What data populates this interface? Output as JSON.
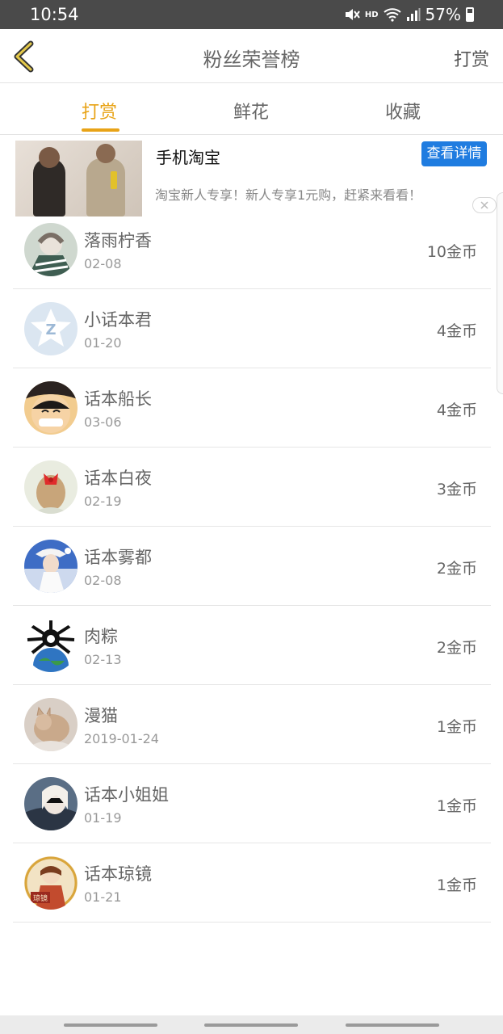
{
  "status": {
    "time": "10:54",
    "battery": "57%",
    "network_label": "HD"
  },
  "header": {
    "title": "粉丝荣誉榜",
    "right_action": "打赏"
  },
  "tabs": [
    {
      "label": "打赏",
      "active": true
    },
    {
      "label": "鲜花",
      "active": false
    },
    {
      "label": "收藏",
      "active": false
    }
  ],
  "ad": {
    "title": "手机淘宝",
    "button": "查看详情",
    "description": "淘宝新人专享！新人专享1元购，赶紧来看看！"
  },
  "list": [
    {
      "name": "落雨柠香",
      "date": "02-08",
      "coins": "10金币"
    },
    {
      "name": "小话本君",
      "date": "01-20",
      "coins": "4金币"
    },
    {
      "name": "话本船长",
      "date": "03-06",
      "coins": "4金币"
    },
    {
      "name": "话本白夜",
      "date": "02-19",
      "coins": "3金币"
    },
    {
      "name": "话本雾都",
      "date": "02-08",
      "coins": "2金币"
    },
    {
      "name": "肉粽",
      "date": "02-13",
      "coins": "2金币"
    },
    {
      "name": "漫猫",
      "date": "2019-01-24",
      "coins": "1金币"
    },
    {
      "name": "话本小姐姐",
      "date": "01-19",
      "coins": "1金币"
    },
    {
      "name": "话本琼镜",
      "date": "01-21",
      "coins": "1金币"
    }
  ],
  "colors": {
    "accent": "#e8a317",
    "ad_button": "#1f7ce0",
    "status_bar": "#4a4a4a"
  }
}
